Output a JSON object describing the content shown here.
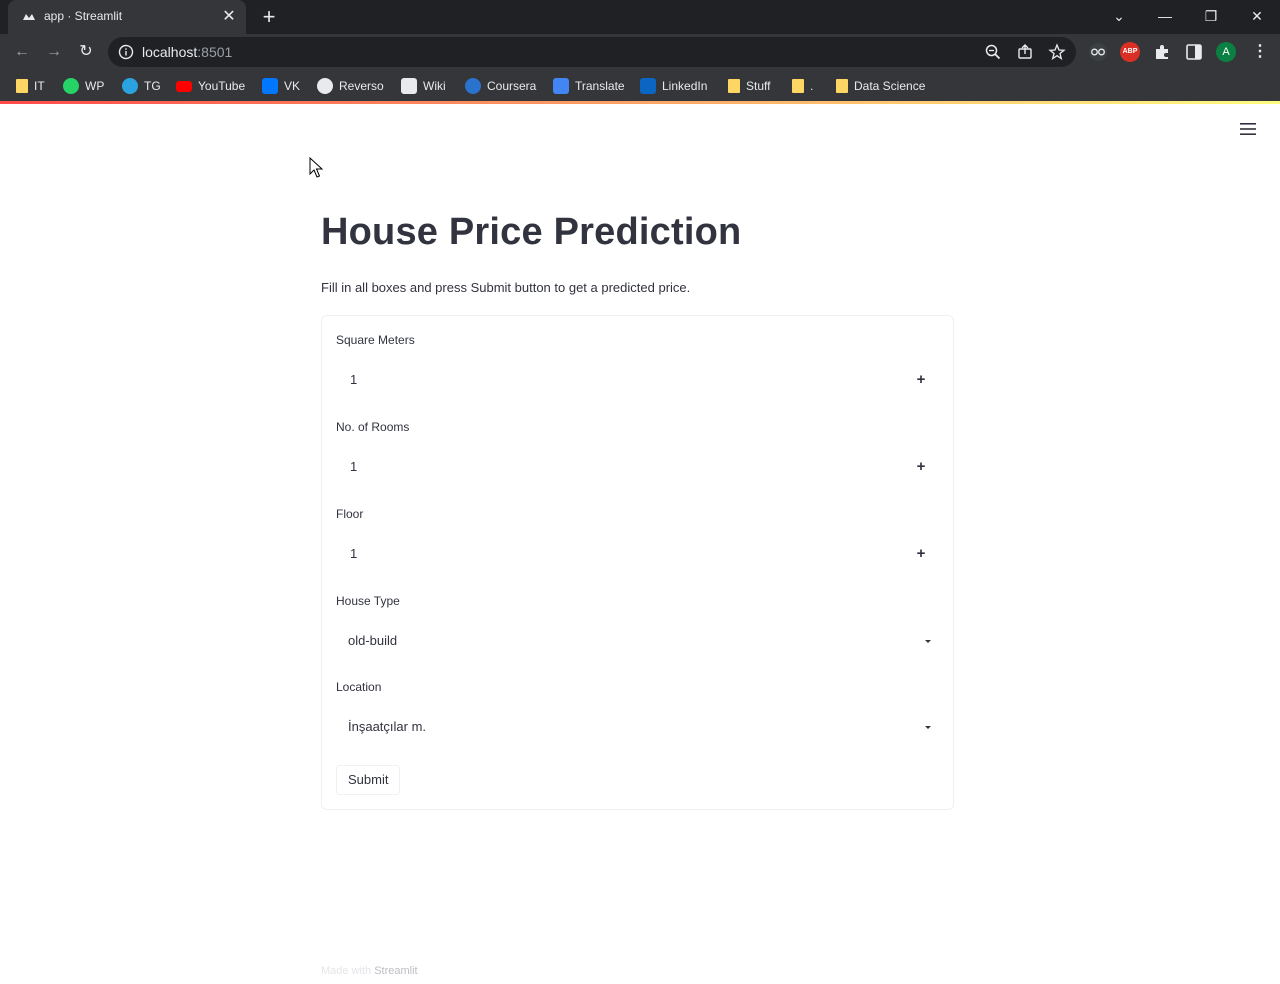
{
  "browser": {
    "tab_title": "app · Streamlit",
    "url_host": "localhost",
    "url_port": ":8501",
    "profile_initial": "A",
    "abp_label": "ABP",
    "bookmarks": [
      {
        "label": "IT",
        "icon": "folder-icon"
      },
      {
        "label": "WP",
        "icon": "whatsapp-icon"
      },
      {
        "label": "TG",
        "icon": "telegram-icon"
      },
      {
        "label": "YouTube",
        "icon": "youtube-icon"
      },
      {
        "label": "VK",
        "icon": "vk-icon"
      },
      {
        "label": "Reverso",
        "icon": "reverso-icon"
      },
      {
        "label": "Wiki",
        "icon": "wikipedia-icon"
      },
      {
        "label": "Coursera",
        "icon": "coursera-icon"
      },
      {
        "label": "Translate",
        "icon": "translate-icon"
      },
      {
        "label": "LinkedIn",
        "icon": "linkedin-icon"
      },
      {
        "label": "Stuff",
        "icon": "folder-icon"
      },
      {
        "label": ".",
        "icon": "folder-icon"
      },
      {
        "label": "Data Science",
        "icon": "folder-icon"
      }
    ]
  },
  "app": {
    "title": "House Price Prediction",
    "description": "Fill in all boxes and press Submit button to get a predicted price.",
    "form": {
      "square_meters": {
        "label": "Square Meters",
        "value": "1"
      },
      "rooms": {
        "label": "No. of Rooms",
        "value": "1"
      },
      "floor": {
        "label": "Floor",
        "value": "1"
      },
      "house_type": {
        "label": "House Type",
        "value": "old-build"
      },
      "location": {
        "label": "Location",
        "value": "İnşaatçılar m."
      },
      "submit_label": "Submit"
    },
    "footer": {
      "made_with": "Made with",
      "brand": "Streamlit"
    }
  },
  "colors": {
    "text": "#31333f",
    "decoration_start": "#ff4b4b",
    "decoration_end": "#fffd80"
  }
}
